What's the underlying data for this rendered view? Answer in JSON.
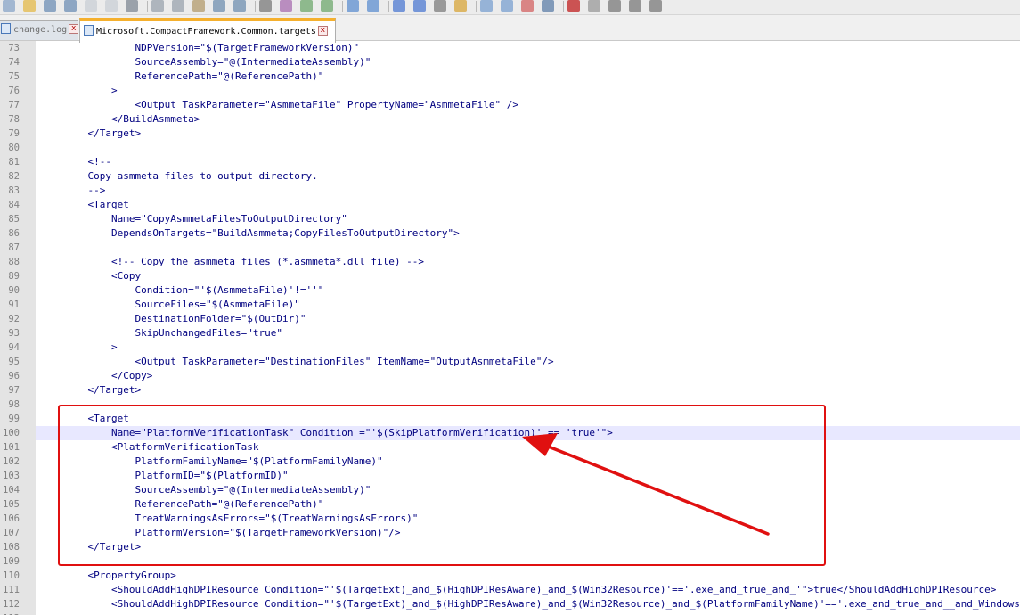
{
  "tabs": [
    {
      "label": "change.log",
      "active": false
    },
    {
      "label": "Microsoft.CompactFramework.Common.targets",
      "active": true
    }
  ],
  "toolbar": {
    "icons": [
      "new-file-icon",
      "open-file-icon",
      "save-icon",
      "save-all-icon",
      "close-icon",
      "close-all-icon",
      "print-icon",
      "cut-icon",
      "copy-icon",
      "paste-icon",
      "undo-icon",
      "redo-icon",
      "find-icon",
      "replace-icon",
      "zoom-in-icon",
      "zoom-out-icon",
      "sync-scroll-vertical-icon",
      "sync-scroll-horizontal-icon",
      "word-wrap-icon",
      "show-all-chars-icon",
      "indent-guide-icon",
      "language-icon",
      "doc-map-icon",
      "function-list-icon",
      "folder-workspace-icon",
      "monitor-icon",
      "record-macro-icon",
      "stop-record-icon",
      "play-macro-icon",
      "run-macro-multiple-icon",
      "save-macro-icon"
    ]
  },
  "editor": {
    "highlighted_line": 100,
    "lines": [
      {
        "n": "73",
        "text": "            NDPVersion=\"$(TargetFrameworkVersion)\""
      },
      {
        "n": "74",
        "text": "            SourceAssembly=\"@(IntermediateAssembly)\""
      },
      {
        "n": "75",
        "text": "            ReferencePath=\"@(ReferencePath)\""
      },
      {
        "n": "76",
        "text": "        >"
      },
      {
        "n": "77",
        "text": "            <Output TaskParameter=\"AsmmetaFile\" PropertyName=\"AsmmetaFile\" />"
      },
      {
        "n": "78",
        "text": "        </BuildAsmmeta>"
      },
      {
        "n": "79",
        "text": "    </Target>"
      },
      {
        "n": "80",
        "text": ""
      },
      {
        "n": "81",
        "text": "    <!--"
      },
      {
        "n": "82",
        "text": "    Copy asmmeta files to output directory."
      },
      {
        "n": "83",
        "text": "    -->"
      },
      {
        "n": "84",
        "text": "    <Target"
      },
      {
        "n": "85",
        "text": "        Name=\"CopyAsmmetaFilesToOutputDirectory\""
      },
      {
        "n": "86",
        "text": "        DependsOnTargets=\"BuildAsmmeta;CopyFilesToOutputDirectory\">"
      },
      {
        "n": "87",
        "text": ""
      },
      {
        "n": "88",
        "text": "        <!-- Copy the asmmeta files (*.asmmeta*.dll file) -->"
      },
      {
        "n": "89",
        "text": "        <Copy"
      },
      {
        "n": "90",
        "text": "            Condition=\"'$(AsmmetaFile)'!=''\""
      },
      {
        "n": "91",
        "text": "            SourceFiles=\"$(AsmmetaFile)\""
      },
      {
        "n": "92",
        "text": "            DestinationFolder=\"$(OutDir)\""
      },
      {
        "n": "93",
        "text": "            SkipUnchangedFiles=\"true\""
      },
      {
        "n": "94",
        "text": "        >"
      },
      {
        "n": "95",
        "text": "            <Output TaskParameter=\"DestinationFiles\" ItemName=\"OutputAsmmetaFile\"/>"
      },
      {
        "n": "96",
        "text": "        </Copy>"
      },
      {
        "n": "97",
        "text": "    </Target>"
      },
      {
        "n": "98",
        "text": ""
      },
      {
        "n": "99",
        "text": "    <Target"
      },
      {
        "n": "100",
        "text": "        Name=\"PlatformVerificationTask\" Condition =\"'$(SkipPlatformVerification)' == 'true'\">"
      },
      {
        "n": "101",
        "text": "        <PlatformVerificationTask"
      },
      {
        "n": "102",
        "text": "            PlatformFamilyName=\"$(PlatformFamilyName)\""
      },
      {
        "n": "103",
        "text": "            PlatformID=\"$(PlatformID)\""
      },
      {
        "n": "104",
        "text": "            SourceAssembly=\"@(IntermediateAssembly)\""
      },
      {
        "n": "105",
        "text": "            ReferencePath=\"@(ReferencePath)\""
      },
      {
        "n": "106",
        "text": "            TreatWarningsAsErrors=\"$(TreatWarningsAsErrors)\""
      },
      {
        "n": "107",
        "text": "            PlatformVersion=\"$(TargetFrameworkVersion)\"/>"
      },
      {
        "n": "108",
        "text": "    </Target>"
      },
      {
        "n": "109",
        "text": ""
      },
      {
        "n": "110",
        "text": "    <PropertyGroup>"
      },
      {
        "n": "111",
        "text": "        <ShouldAddHighDPIResource Condition=\"'$(TargetExt)_and_$(HighDPIResAware)_and_$(Win32Resource)'=='.exe_and_true_and_'\">true</ShouldAddHighDPIResource>"
      },
      {
        "n": "112",
        "text": "        <ShouldAddHighDPIResource Condition=\"'$(TargetExt)_and_$(HighDPIResAware)_and_$(Win32Resource)_and_$(PlatformFamilyName)'=='.exe_and_true_and__and_WindowsCE'\">true</ShouldAddHighDPIResource>"
      },
      {
        "n": "113",
        "text": ""
      }
    ]
  },
  "colors": {
    "annotation_red": "#e01010",
    "code_text": "#000080",
    "active_tab_accent": "#f5b02e",
    "current_line": "#e8e8ff"
  }
}
